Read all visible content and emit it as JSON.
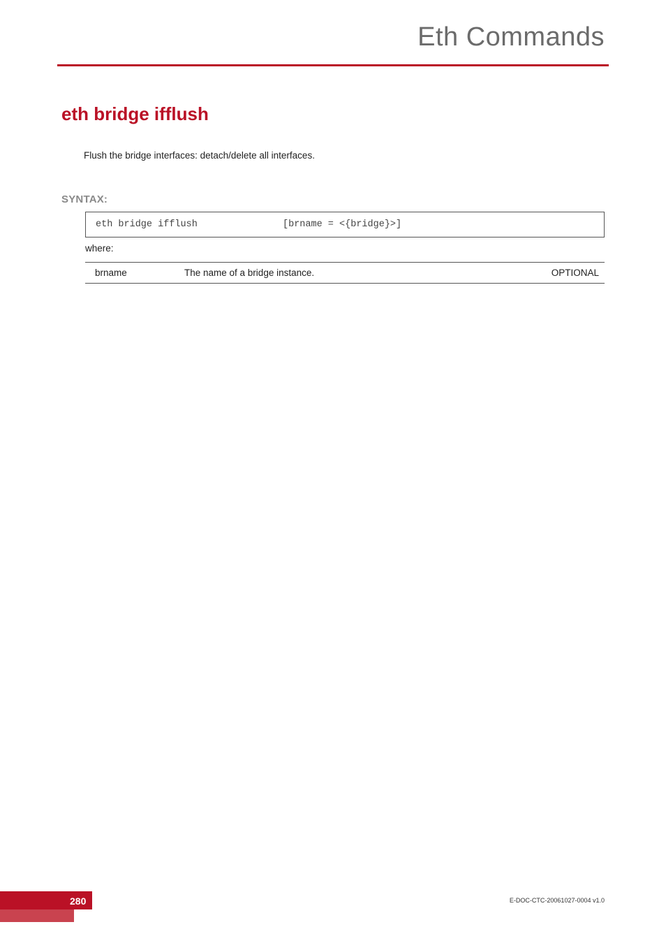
{
  "header": {
    "pageTitle": "Eth Commands"
  },
  "section": {
    "title": "eth bridge ifflush",
    "description": "Flush the bridge interfaces: detach/delete all interfaces."
  },
  "syntax": {
    "label": "SYNTAX:",
    "command": "eth bridge ifflush",
    "args": "[brname = <{bridge}>]",
    "whereLabel": "where:",
    "params": [
      {
        "name": "brname",
        "desc": "The name of  a bridge instance.",
        "opt": "OPTIONAL"
      }
    ]
  },
  "footer": {
    "pageNumber": "280",
    "docCode": "E-DOC-CTC-20061027-0004 v1.0"
  }
}
